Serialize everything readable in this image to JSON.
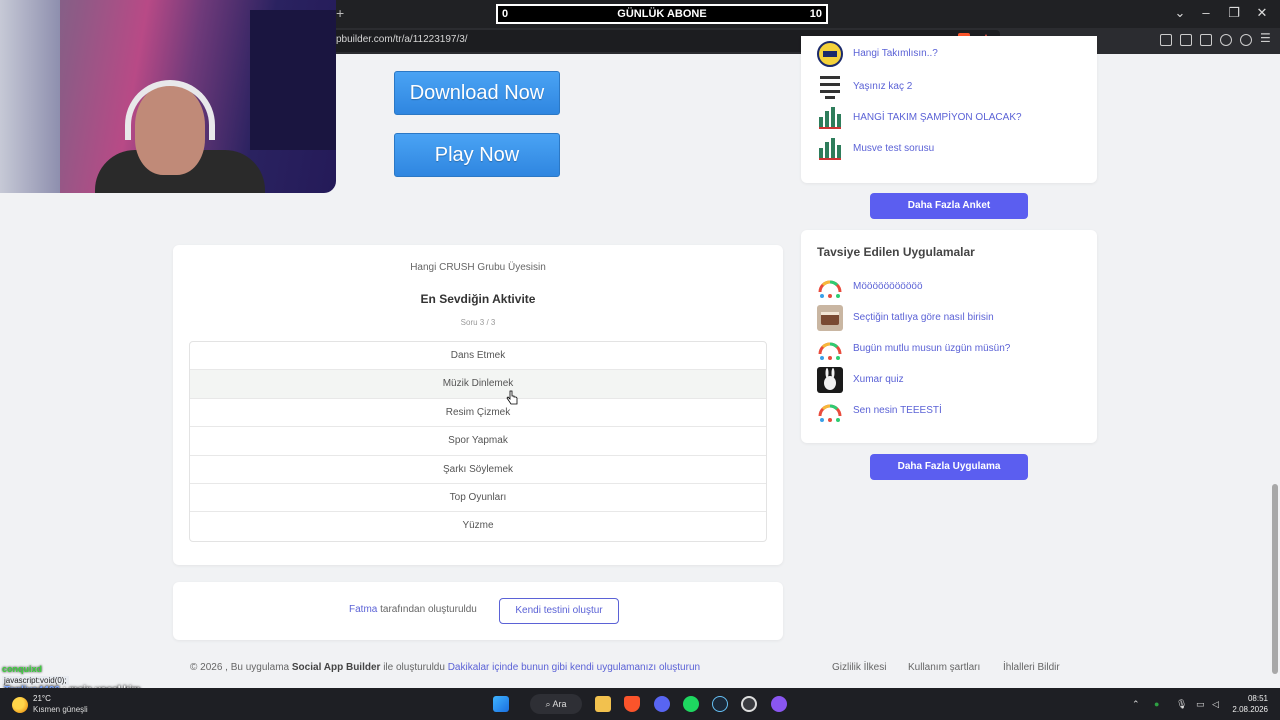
{
  "browser": {
    "url": "pbuilder.com/tr/a/11223197/3/",
    "new_tab": "+"
  },
  "abone": {
    "left": "0",
    "title": "GÜNLÜK ABONE",
    "right": "10"
  },
  "buttons": {
    "download": "Download Now",
    "play": "Play Now"
  },
  "quiz": {
    "app_title": "Hangi CRUSH Grubu Üyesisin",
    "question": "En Sevdiğin Aktivite",
    "progress": "Soru 3 / 3",
    "options": [
      "Dans Etmek",
      "Müzik Dinlemek",
      "Resim Çizmek",
      "Spor Yapmak",
      "Şarkı Söylemek",
      "Top Oyunları",
      "Yüzme"
    ]
  },
  "author": {
    "name": "Fatma",
    "suffix": "tarafından oluşturuldu",
    "create_label": "Kendi testini oluştur"
  },
  "footer": {
    "prefix": "© 2026 , Bu uygulama",
    "brand": "Social App Builder",
    "middle": "ile oluşturuldu",
    "link": "Dakikalar içinde bunun gibi kendi uygulamanızı oluşturun",
    "privacy": "Gizlilik İlkesi",
    "terms": "Kullanım şartları",
    "report": "İhlalleri Bildir"
  },
  "polls": {
    "items": [
      {
        "label": "Hangi Takımlısın..?",
        "icon": "fenerbahce-logo-icon"
      },
      {
        "label": "Yaşınız kaç 2",
        "icon": "numbers-icon"
      },
      {
        "label": "HANGİ TAKIM ŞAMPİYON OLACAK?",
        "icon": "bar-chart-icon"
      },
      {
        "label": "Musve test sorusu",
        "icon": "bar-chart-icon"
      }
    ],
    "more_label": "Daha Fazla Anket"
  },
  "apps": {
    "title": "Tavsiye Edilen Uygulamalar",
    "items": [
      {
        "label": "Mööööööööööö",
        "icon": "gauge-icon"
      },
      {
        "label": "Seçtiğin tatlıya göre nasıl birisin",
        "icon": "cake-thumbnail-icon"
      },
      {
        "label": "Bugün mutlu musun üzgün müsün?",
        "icon": "gauge-icon"
      },
      {
        "label": "Xumar quiz",
        "icon": "rabbit-thumbnail-icon"
      },
      {
        "label": "Sen nesin TEEESTİ",
        "icon": "gauge-icon"
      }
    ],
    "more_label": "Daha Fazla Uygulama"
  },
  "chat": {
    "line1_user": "conquixd",
    "status": "javascript:void(0);",
    "line2_user": "Tanliva4406",
    "line2_text": ": main vocal kim"
  },
  "taskbar": {
    "temperature": "21°C",
    "weather": "Kısmen güneşli",
    "search": "Ara",
    "time": "08:51",
    "date": "2.08.2026"
  },
  "colors": {
    "accent": "#5b5ef0",
    "link": "#5b62d6",
    "download_button": "#3a93ea"
  }
}
